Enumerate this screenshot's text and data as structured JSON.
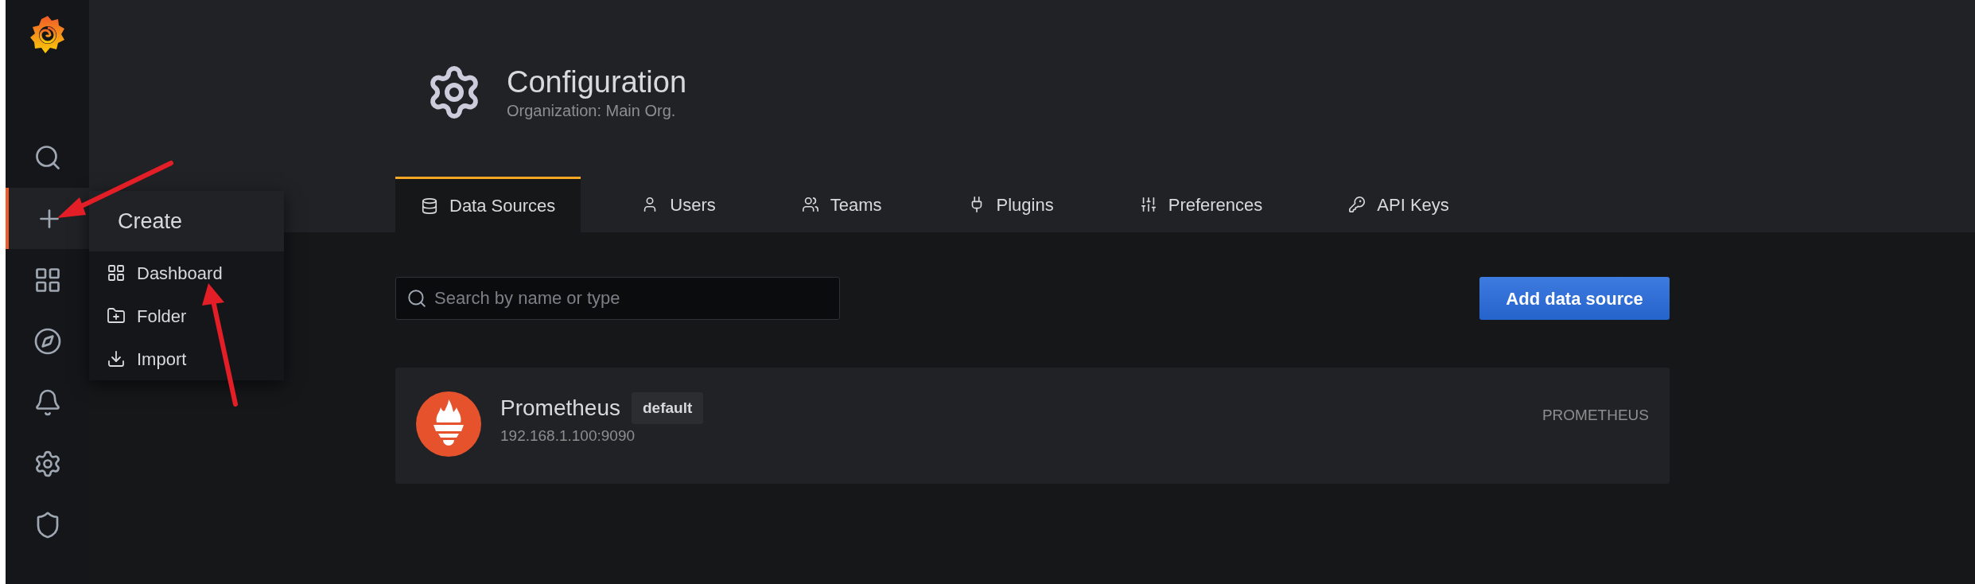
{
  "sidebar": {
    "items": [
      {
        "kind": "search",
        "selected": false
      },
      {
        "kind": "plus",
        "selected": true
      },
      {
        "kind": "grid",
        "selected": false
      },
      {
        "kind": "compass",
        "selected": false
      },
      {
        "kind": "bell",
        "selected": false
      },
      {
        "kind": "gear",
        "selected": false
      },
      {
        "kind": "shield",
        "selected": false
      }
    ]
  },
  "create_menu": {
    "title": "Create",
    "items": [
      {
        "kind": "grid",
        "label": "Dashboard"
      },
      {
        "kind": "folder",
        "label": "Folder"
      },
      {
        "kind": "import",
        "label": "Import"
      }
    ]
  },
  "header": {
    "title": "Configuration",
    "subtitle": "Organization: Main Org."
  },
  "tabs": [
    {
      "kind": "database",
      "label": "Data Sources",
      "selected": true
    },
    {
      "kind": "user",
      "label": "Users",
      "selected": false
    },
    {
      "kind": "users",
      "label": "Teams",
      "selected": false
    },
    {
      "kind": "plug",
      "label": "Plugins",
      "selected": false
    },
    {
      "kind": "sliders",
      "label": "Preferences",
      "selected": false
    },
    {
      "kind": "key",
      "label": "API Keys",
      "selected": false
    }
  ],
  "search": {
    "placeholder": "Search by name or type"
  },
  "add_button": "Add data source",
  "data_sources": [
    {
      "name": "Prometheus",
      "badge": "default",
      "url": "192.168.1.100:9090",
      "type": "PROMETHEUS"
    }
  ]
}
